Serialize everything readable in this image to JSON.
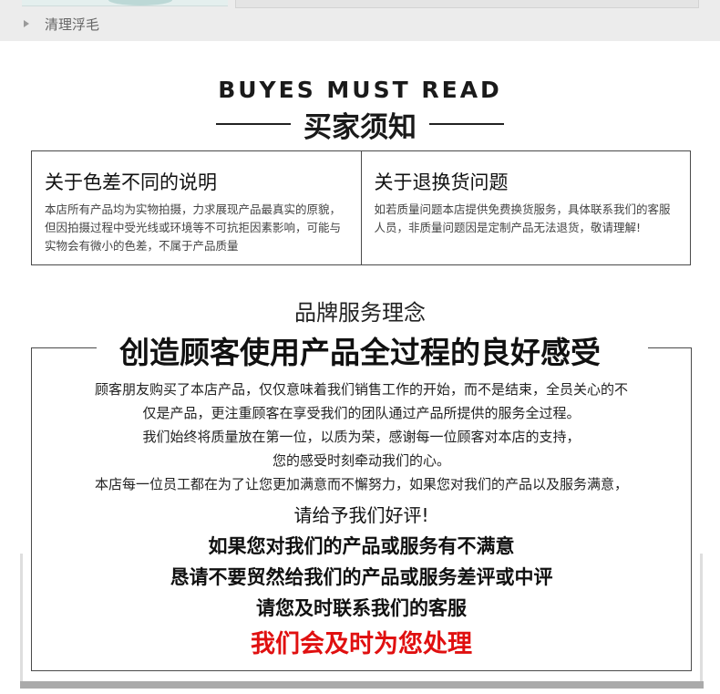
{
  "top": {
    "item_label": "清理浮毛"
  },
  "header": {
    "title_en": "BUYES MUST READ",
    "title_cn": "买家须知"
  },
  "info": [
    {
      "title": "关于色差不同的说明",
      "body": "本店所有产品均为实物拍摄，力求展现产品最真实的原貌，但因拍摄过程中受光线或环境等不可抗拒因素影响，可能与实物会有微小的色差，不属于产品质量"
    },
    {
      "title": "关于退换货问题",
      "body": "如若质量问题本店提供免费换货服务，具体联系我们的客服人员，非质量问题因是定制产品无法退货，敬请理解!"
    }
  ],
  "service": {
    "brand_title": "品牌服务理念",
    "slogan": "创造顾客使用产品全过程的良好感受",
    "paragraphs": [
      "顾客朋友购买了本店产品，仅仅意味着我们销售工作的开始，而不是结束，全员关心的不",
      "仅是产品，更注重顾客在享受我们的团队通过产品所提供的服务全过程。",
      "我们始终将质量放在第一位，以质为荣，感谢每一位顾客对本店的支持，",
      "您的感受时刻牵动我们的心。",
      "本店每一位员工都在为了让您更加满意而不懈努力，如果您对我们的产品以及服务满意，"
    ],
    "please_review": "请给予我们好评!",
    "bold_lines": [
      "如果您对我们的产品或服务有不满意",
      "恳请不要贸然给我们的产品或服务差评或中评",
      "请您及时联系我们的客服"
    ],
    "red_line": "我们会及时为您处理"
  },
  "colors": {
    "accent_red": "#e01010",
    "border": "#4a4a4a",
    "top_strip": "#ececec"
  }
}
